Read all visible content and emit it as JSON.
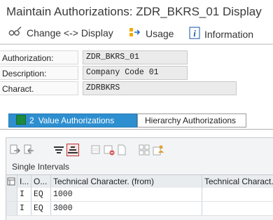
{
  "window": {
    "title": "Maintain Authorizations: ZDR_BKRS_01 Display"
  },
  "toolbar": {
    "change_label": "Change <-> Display",
    "usage_label": "Usage",
    "information_label": "Information"
  },
  "form": {
    "authorization_label": "Authorization:",
    "authorization_value": "ZDR_BKRS_01",
    "description_label": "Description:",
    "description_value": "Company Code 01",
    "charact_label": "Charact.",
    "charact_value": "ZDRBKRS"
  },
  "tabs": {
    "value_auth_count": "2",
    "value_auth_label": "Value Authorizations",
    "hierarchy_auth_label": "Hierarchy Authorizations"
  },
  "table": {
    "group_title": "Single Intervals",
    "headers": {
      "col1": "I...",
      "col2": "O...",
      "col3": "Technical Character. (from)",
      "col4": "Technical Charact."
    },
    "rows": [
      {
        "incl": "I",
        "op": "EQ",
        "from": "1000",
        "to": ""
      },
      {
        "incl": "I",
        "op": "EQ",
        "from": "3000",
        "to": ""
      }
    ]
  },
  "icons": {
    "change": "glasses-pencil-icon",
    "usage": "usage-icon",
    "information": "info-icon"
  },
  "colors": {
    "accent": "#2e8fd0",
    "tab_square": "#1e8a3e"
  }
}
